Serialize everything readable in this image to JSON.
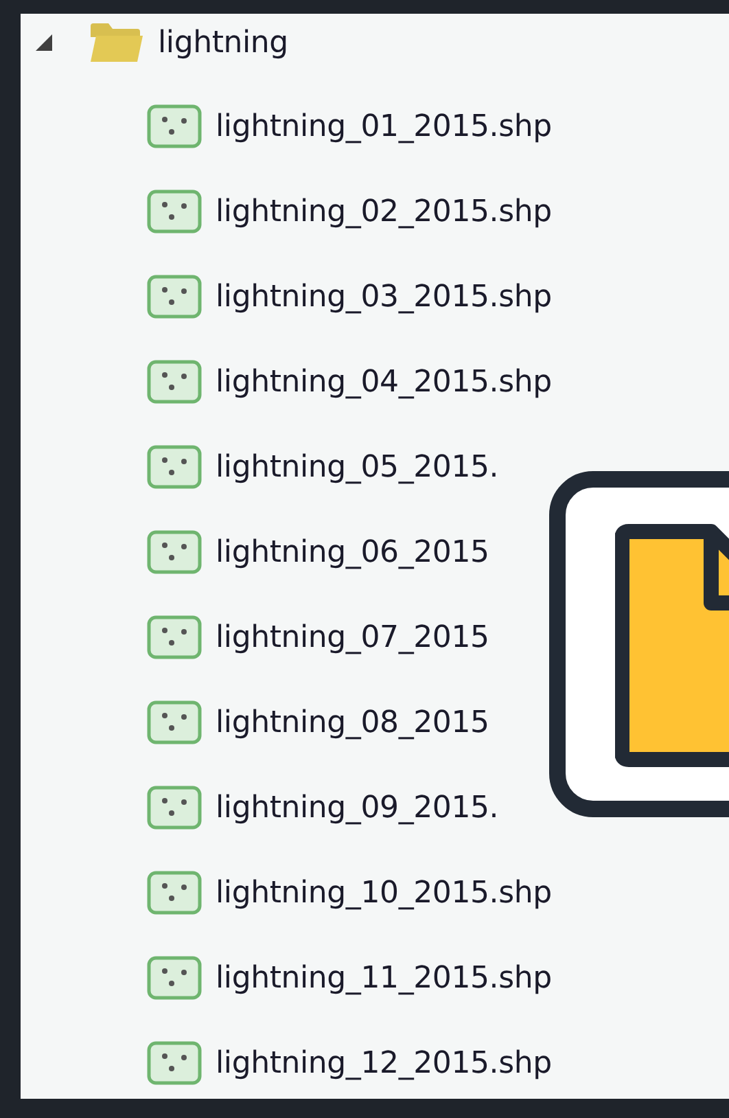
{
  "tree": {
    "folder": {
      "label": "lightning",
      "expanded": true,
      "children": [
        {
          "label": "lightning_01_2015.shp"
        },
        {
          "label": "lightning_02_2015.shp"
        },
        {
          "label": "lightning_03_2015.shp"
        },
        {
          "label": "lightning_04_2015.shp"
        },
        {
          "label": "lightning_05_2015."
        },
        {
          "label": "lightning_06_2015"
        },
        {
          "label": "lightning_07_2015"
        },
        {
          "label": "lightning_08_2015"
        },
        {
          "label": "lightning_09_2015."
        },
        {
          "label": "lightning_10_2015.shp"
        },
        {
          "label": "lightning_11_2015.shp"
        },
        {
          "label": "lightning_12_2015.shp"
        }
      ]
    }
  }
}
